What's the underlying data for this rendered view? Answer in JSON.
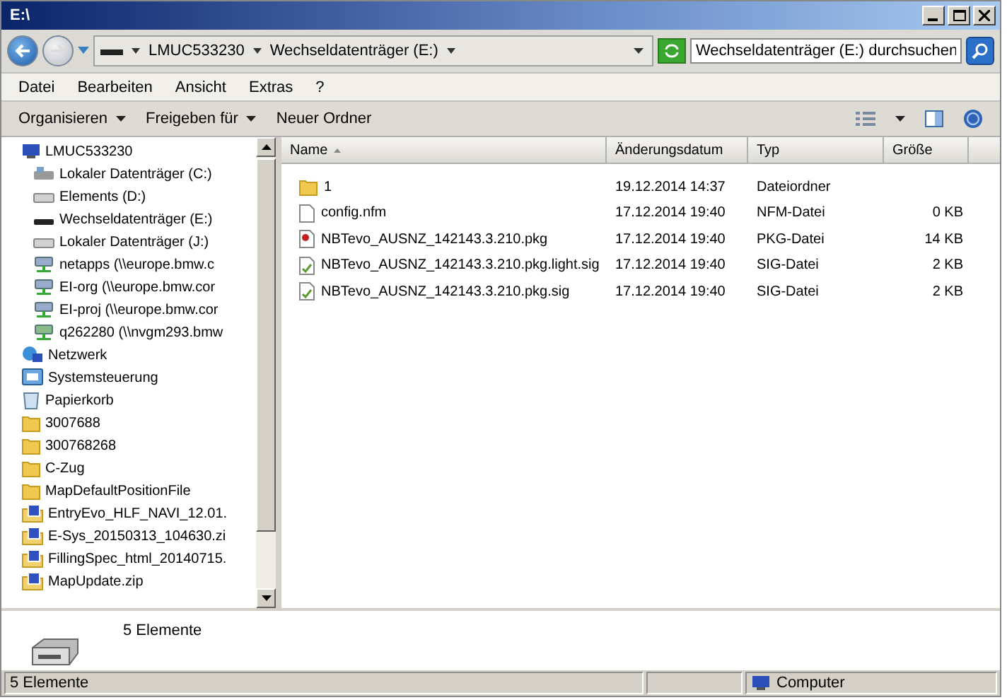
{
  "window": {
    "title": "E:\\"
  },
  "address": {
    "crumbs": [
      "LMUC533230",
      "Wechseldatenträger (E:)"
    ]
  },
  "search": {
    "placeholder": "Wechseldatenträger (E:) durchsuchen"
  },
  "menu": [
    "Datei",
    "Bearbeiten",
    "Ansicht",
    "Extras",
    "?"
  ],
  "toolbar": [
    {
      "label": "Organisieren",
      "dropdown": true
    },
    {
      "label": "Freigeben für",
      "dropdown": true
    },
    {
      "label": "Neuer Ordner",
      "dropdown": false
    }
  ],
  "sidebar": {
    "items": [
      {
        "label": "LMUC533230",
        "kind": "computer",
        "children": [
          {
            "label": "Lokaler Datenträger (C:)",
            "kind": "sysdrive"
          },
          {
            "label": "Elements (D:)",
            "kind": "drive"
          },
          {
            "label": "Wechseldatenträger (E:)",
            "kind": "removable"
          },
          {
            "label": "Lokaler Datenträger (J:)",
            "kind": "drive"
          },
          {
            "label": "netapps (\\\\europe.bmw.c",
            "kind": "netdrive"
          },
          {
            "label": "EI-org (\\\\europe.bmw.cor",
            "kind": "netdrive"
          },
          {
            "label": "EI-proj (\\\\europe.bmw.cor",
            "kind": "netdrive"
          },
          {
            "label": "q262280 (\\\\nvgm293.bmw",
            "kind": "netdrive2"
          }
        ]
      },
      {
        "label": "Netzwerk",
        "kind": "network"
      },
      {
        "label": "Systemsteuerung",
        "kind": "control"
      },
      {
        "label": "Papierkorb",
        "kind": "trash"
      },
      {
        "label": "3007688",
        "kind": "folder"
      },
      {
        "label": "300768268",
        "kind": "folder"
      },
      {
        "label": "C-Zug",
        "kind": "folder"
      },
      {
        "label": "MapDefaultPositionFile",
        "kind": "folder"
      },
      {
        "label": "EntryEvo_HLF_NAVI_12.01.",
        "kind": "zip"
      },
      {
        "label": "E-Sys_20150313_104630.zi",
        "kind": "zip"
      },
      {
        "label": "FillingSpec_html_20140715.",
        "kind": "zip"
      },
      {
        "label": "MapUpdate.zip",
        "kind": "zip"
      }
    ]
  },
  "table": {
    "columns": [
      "Name",
      "Änderungsdatum",
      "Typ",
      "Größe"
    ],
    "rows": [
      {
        "kind": "folder",
        "name": "1",
        "date": "19.12.2014 14:37",
        "type": "Dateiordner"
      },
      {
        "kind": "file",
        "name": "config.nfm",
        "date": "17.12.2014 19:40",
        "type": "NFM-Datei",
        "size": "0 KB"
      },
      {
        "kind": "pkg",
        "name": "NBTevo_AUSNZ_142143.3.210.pkg",
        "date": "17.12.2014 19:40",
        "type": "PKG-Datei",
        "size": "14 KB"
      },
      {
        "kind": "sig",
        "name": "NBTevo_AUSNZ_142143.3.210.pkg.light.sig",
        "date": "17.12.2014 19:40",
        "type": "SIG-Datei",
        "size": "2 KB"
      },
      {
        "kind": "sig",
        "name": "NBTevo_AUSNZ_142143.3.210.pkg.sig",
        "date": "17.12.2014 19:40",
        "type": "SIG-Datei",
        "size": "2 KB"
      }
    ]
  },
  "details": {
    "count": "5 Elemente"
  },
  "status_bar": {
    "left": "5 Elemente",
    "right": "Computer"
  }
}
